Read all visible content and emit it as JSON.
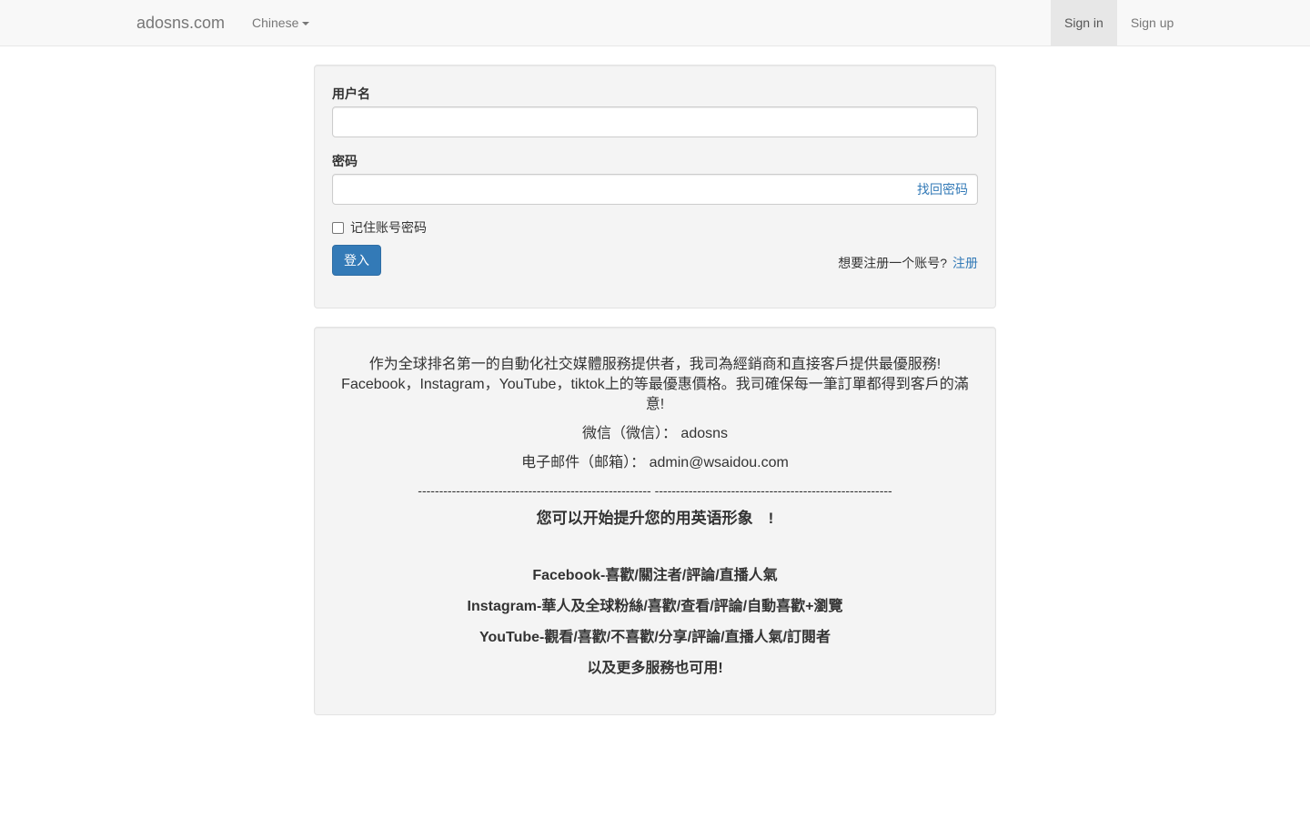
{
  "navbar": {
    "brand": "adosns.com",
    "language": "Chinese",
    "sign_in": "Sign in",
    "sign_up": "Sign up"
  },
  "login": {
    "username_label": "用户名",
    "username_value": "",
    "password_label": "密码",
    "password_value": "",
    "forgot_link": "找回密码",
    "remember_label": "记住账号密码",
    "remember_checked": false,
    "login_button": "登入",
    "signup_prompt": "想要注册一个账号?",
    "signup_link": "注册"
  },
  "info": {
    "intro_line1": "作为全球排名第一的自動化社交媒體服務提供者，我司為經銷商和直接客戶提供最優服務!",
    "intro_line2": "Facebook，Instagram，YouTube，tiktok上的等最優惠價格。我司確保每一筆訂單都得到客戶的滿",
    "intro_line3": "意!",
    "wechat": "微信（微信）： adosns",
    "email": "电子邮件（邮箱）： admin@wsaidou.com",
    "divider": "------------------------------------------------------- --------------------------------------------------------",
    "headline": "您可以开始提升您的用英语形象　!",
    "facebook": "Facebook-喜歡/關注者/評論/直播人氣",
    "instagram": "Instagram-華人及全球粉絲/喜歡/查看/評論/自動喜歡+瀏覽",
    "youtube": "YouTube-觀看/喜歡/不喜歡/分享/評論/直播人氣/訂閱者",
    "more": "以及更多服務也可用!"
  },
  "colors": {
    "primary": "#337ab7",
    "navbar_bg": "#f8f8f8",
    "well_bg": "#f4f4f4"
  }
}
